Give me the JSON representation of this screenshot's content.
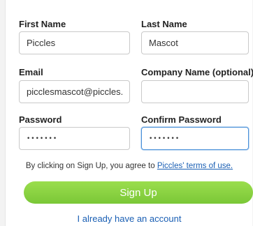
{
  "form": {
    "first_name": {
      "label": "First Name",
      "value": "Piccles"
    },
    "last_name": {
      "label": "Last Name",
      "value": "Mascot"
    },
    "email": {
      "label": "Email",
      "value": "picclesmascot@piccles.cc"
    },
    "company": {
      "label": "Company Name (optional)",
      "value": ""
    },
    "password": {
      "label": "Password",
      "value": "•••••••"
    },
    "confirm_password": {
      "label": "Confirm Password",
      "value": "•••••••"
    }
  },
  "terms": {
    "text": "By clicking on Sign Up, you agree to",
    "link": "Piccles' terms of use."
  },
  "signup_button": "Sign Up",
  "signin_link": "I already have an account",
  "colors": {
    "button_green": "#7ac737",
    "link_blue": "#1a5fb4",
    "focus_border": "#4a90d9"
  }
}
